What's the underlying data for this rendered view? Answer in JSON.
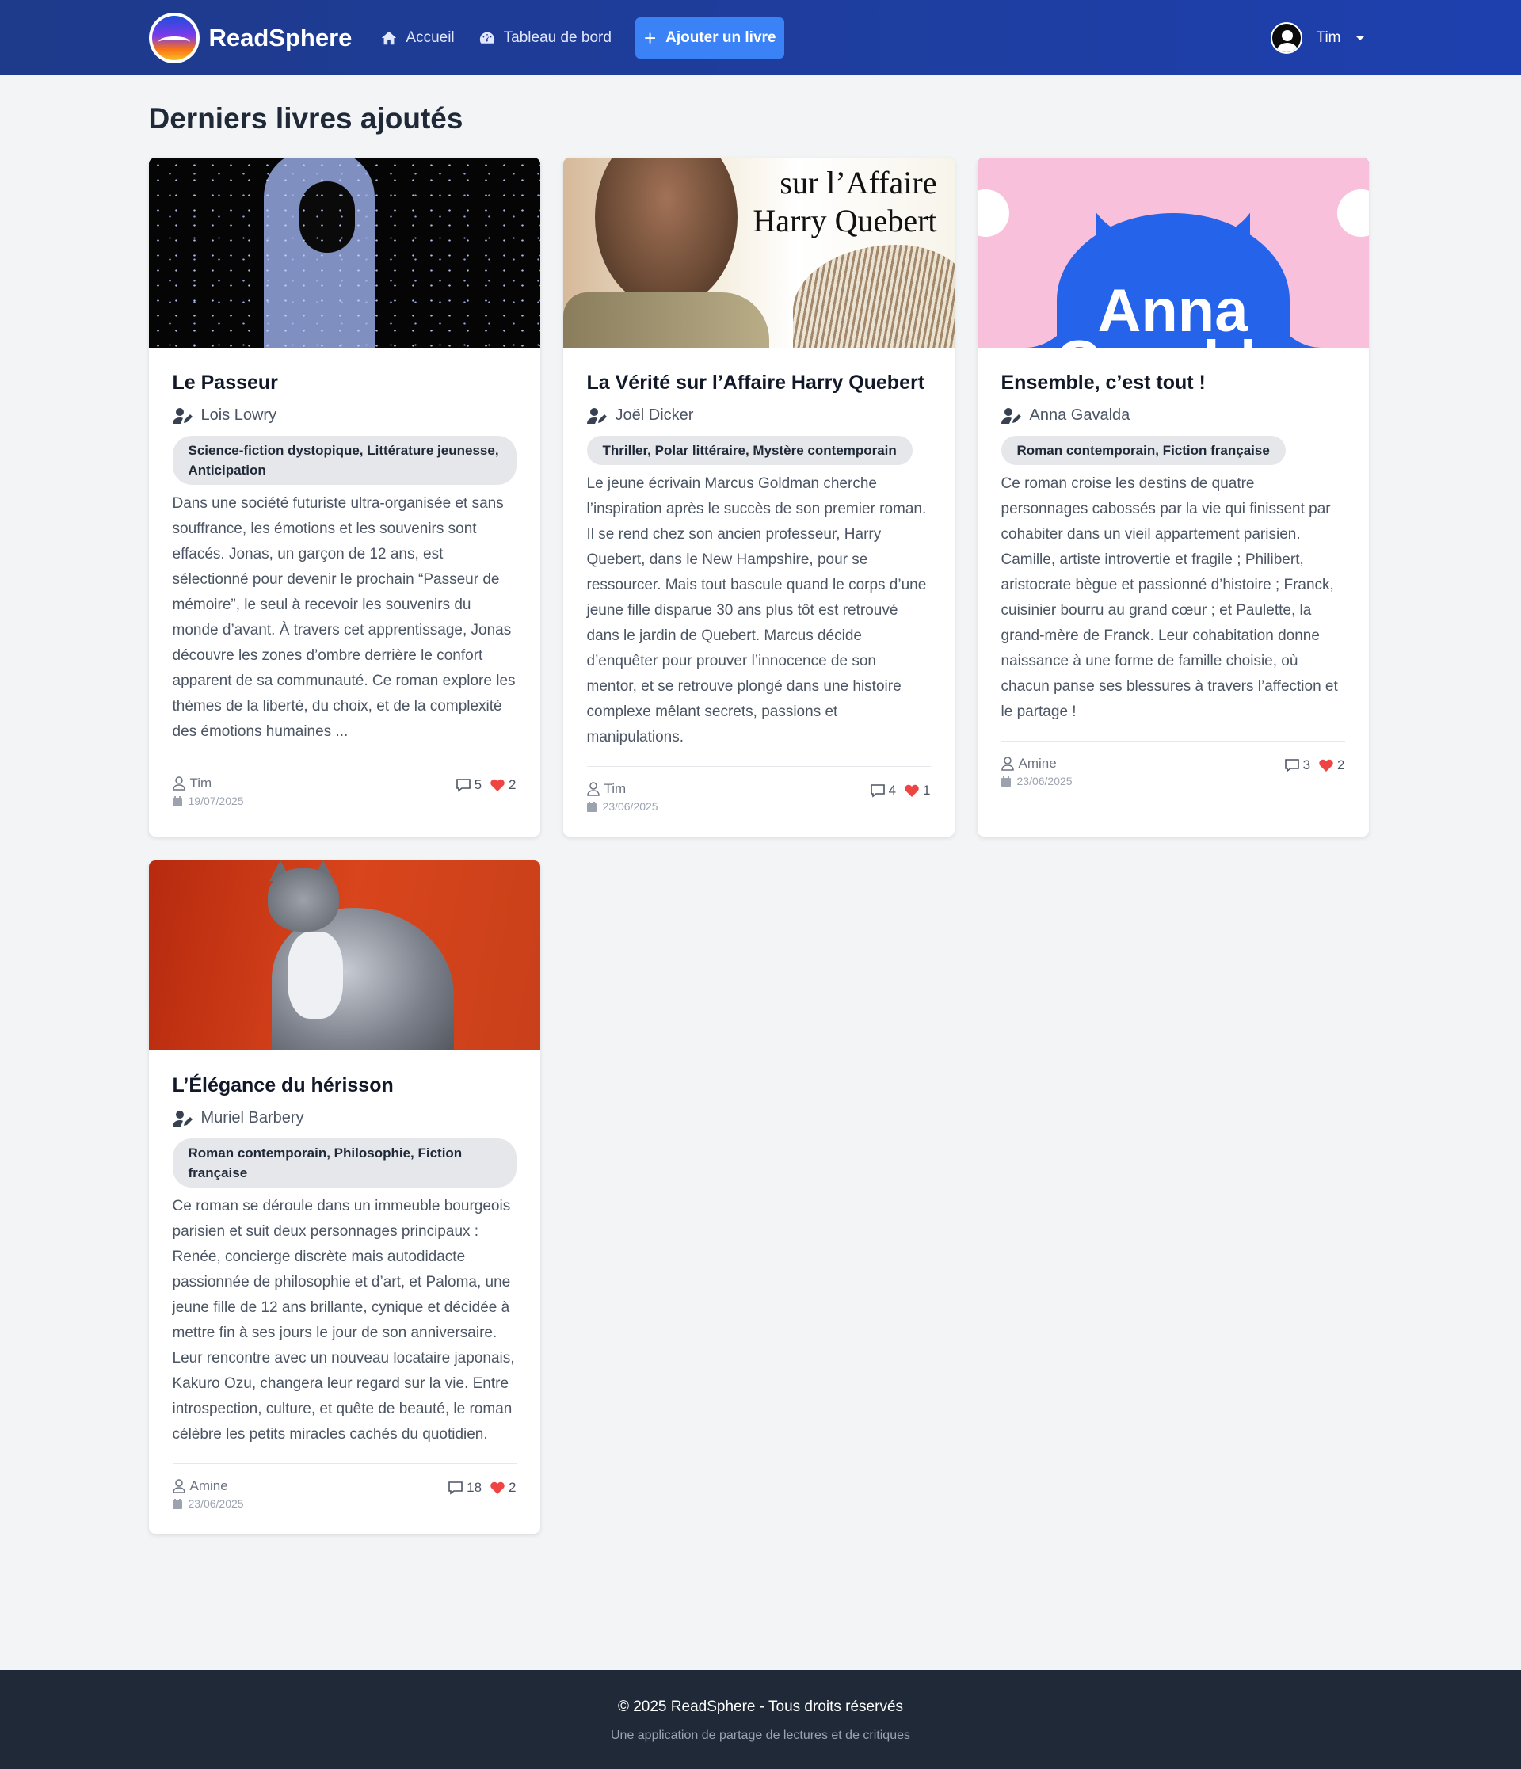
{
  "nav": {
    "brand": "ReadSphere",
    "links": [
      {
        "label": "Accueil",
        "icon": "home-icon"
      },
      {
        "label": "Tableau de bord",
        "icon": "gauge-icon"
      }
    ],
    "add_button": "Ajouter un livre",
    "user": "Tim"
  },
  "page": {
    "title": "Derniers livres ajoutés"
  },
  "books": [
    {
      "title": "Le Passeur",
      "author": "Lois Lowry",
      "genres": "Science-fiction dystopique, Littérature jeunesse, Anticipation",
      "summary": "Dans une société futuriste ultra-organisée et sans souffrance, les émotions et les souvenirs sont effacés. Jonas, un garçon de 12 ans, est sélectionné pour devenir le prochain “Passeur de mémoire”, le seul à recevoir les souvenirs du monde d’avant. À travers cet apprentissage, Jonas découvre les zones d’ombre derrière le confort apparent de sa communauté. Ce roman explore les thèmes de la liberté, du choix, et de la complexité des émotions humaines ...",
      "posted_by": "Tim",
      "date": "19/07/2025",
      "comments": "5",
      "likes": "2"
    },
    {
      "title": "La Vérité sur l’Affaire Harry Quebert",
      "author": "Joël Dicker",
      "genres": "Thriller, Polar littéraire, Mystère contemporain",
      "summary": "Le jeune écrivain Marcus Goldman cherche l’inspiration après le succès de son premier roman. Il se rend chez son ancien professeur, Harry Quebert, dans le New Hampshire, pour se ressourcer. Mais tout bascule quand le corps d’une jeune fille disparue 30 ans plus tôt est retrouvé dans le jardin de Quebert. Marcus décide d’enquêter pour prouver l’innocence de son mentor, et se retrouve plongé dans une histoire complexe mêlant secrets, passions et manipulations.",
      "posted_by": "Tim",
      "date": "23/06/2025",
      "comments": "4",
      "likes": "1",
      "cover_text": [
        "sur l’Affaire",
        "Harry Quebert"
      ]
    },
    {
      "title": "Ensemble, c’est tout !",
      "author": "Anna Gavalda",
      "genres": "Roman contemporain, Fiction française",
      "summary": "Ce roman croise les destins de quatre personnages cabossés par la vie qui finissent par cohabiter dans un vieil appartement parisien. Camille, artiste introvertie et fragile ; Philibert, aristocrate bègue et passionné d’histoire ; Franck, cuisinier bourru au grand cœur ; et Paulette, la grand-mère de Franck. Leur cohabitation donne naissance à une forme de famille choisie, où chacun panse ses blessures à travers l’affection et le partage !",
      "posted_by": "Amine",
      "date": "23/06/2025",
      "comments": "3",
      "likes": "2",
      "cover_text": [
        "Anna",
        "Gavalda"
      ]
    },
    {
      "title": "L’Élégance du hérisson",
      "author": "Muriel Barbery",
      "genres": "Roman contemporain, Philosophie, Fiction française",
      "summary": "Ce roman se déroule dans un immeuble bourgeois parisien et suit deux personnages principaux : Renée, concierge discrète mais autodidacte passionnée de philosophie et d’art, et Paloma, une jeune fille de 12 ans brillante, cynique et décidée à mettre fin à ses jours le jour de son anniversaire. Leur rencontre avec un nouveau locataire japonais, Kakuro Ozu, changera leur regard sur la vie. Entre introspection, culture, et quête de beauté, le roman célèbre les petits miracles cachés du quotidien.",
      "posted_by": "Amine",
      "date": "23/06/2025",
      "comments": "18",
      "likes": "2"
    }
  ],
  "footer": {
    "copyright": "© 2025 ReadSphere - Tous droits réservés",
    "tagline": "Une application de partage de lectures et de critiques"
  },
  "colors": {
    "nav": "#1e40af",
    "accent": "#3b82f6",
    "like": "#ef4444",
    "footer": "#1f2937"
  }
}
